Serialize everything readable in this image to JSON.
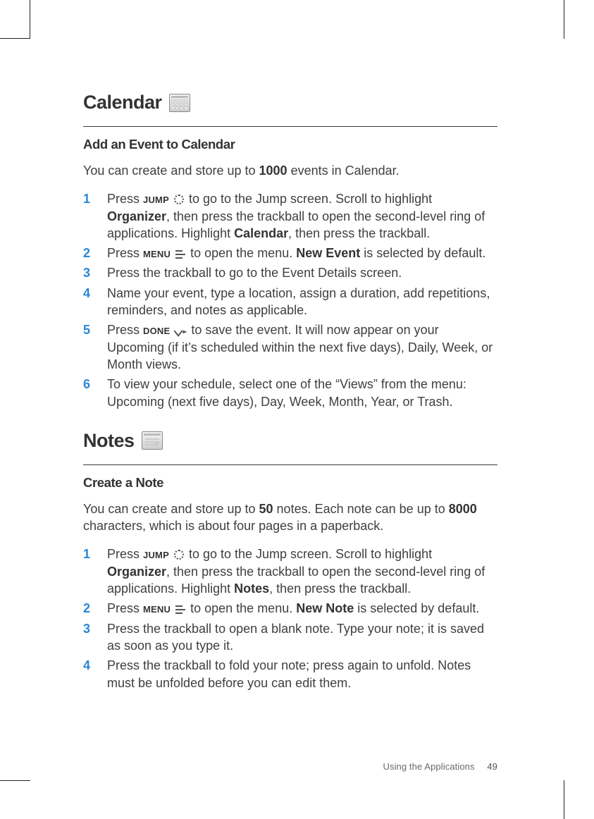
{
  "footer": {
    "section": "Using the Applications",
    "page": "49"
  },
  "keys": {
    "jump": "JUMP",
    "menu": "MENU",
    "done": "DONE"
  },
  "calendar": {
    "title": "Calendar",
    "sub": "Add an Event to Calendar",
    "intro_a": "You can create and store up to ",
    "intro_b": "1000",
    "intro_c": " events in Calendar.",
    "steps": [
      {
        "n": "1",
        "parts": [
          {
            "t": "text",
            "v": "Press "
          },
          {
            "t": "key",
            "v": "jump"
          },
          {
            "t": "glyph",
            "v": "jump"
          },
          {
            "t": "text",
            "v": " to go to the Jump screen. Scroll to highlight "
          },
          {
            "t": "bold",
            "v": "Organizer"
          },
          {
            "t": "text",
            "v": ", then press the trackball to open the second-level ring of applications. Highlight "
          },
          {
            "t": "bold",
            "v": "Calendar"
          },
          {
            "t": "text",
            "v": ", then press the trackball."
          }
        ]
      },
      {
        "n": "2",
        "parts": [
          {
            "t": "text",
            "v": "Press "
          },
          {
            "t": "key",
            "v": "menu"
          },
          {
            "t": "glyph",
            "v": "menu"
          },
          {
            "t": "text",
            "v": " to open the menu. "
          },
          {
            "t": "bold",
            "v": "New Event"
          },
          {
            "t": "text",
            "v": " is selected by default."
          }
        ]
      },
      {
        "n": "3",
        "parts": [
          {
            "t": "text",
            "v": "Press the trackball to go to the Event Details screen."
          }
        ]
      },
      {
        "n": "4",
        "parts": [
          {
            "t": "text",
            "v": "Name your event, type a location, assign a duration, add repetitions, reminders, and notes as applicable."
          }
        ]
      },
      {
        "n": "5",
        "parts": [
          {
            "t": "text",
            "v": "Press "
          },
          {
            "t": "key",
            "v": "done"
          },
          {
            "t": "glyph",
            "v": "done"
          },
          {
            "t": "text",
            "v": " to save the event. It will now appear on your Upcoming (if it’s scheduled within the next five days), Daily, Week, or Month views."
          }
        ]
      },
      {
        "n": "6",
        "parts": [
          {
            "t": "text",
            "v": "To view your schedule, select one of the “Views” from the menu: Upcoming (next five days), Day, Week, Month, Year, or Trash."
          }
        ]
      }
    ]
  },
  "notes": {
    "title": "Notes",
    "sub": "Create a Note",
    "intro_a": "You can create and store up to ",
    "intro_b": "50",
    "intro_c": " notes. Each note can be up to ",
    "intro_d": "8000",
    "intro_e": " characters, which is about four pages in a paperback.",
    "steps": [
      {
        "n": "1",
        "parts": [
          {
            "t": "text",
            "v": "Press "
          },
          {
            "t": "key",
            "v": "jump"
          },
          {
            "t": "glyph",
            "v": "jump"
          },
          {
            "t": "text",
            "v": " to go to the Jump screen. Scroll to highlight "
          },
          {
            "t": "bold",
            "v": "Organizer"
          },
          {
            "t": "text",
            "v": ", then press the trackball to open the second-level ring of applications. Highlight "
          },
          {
            "t": "bold",
            "v": "Notes"
          },
          {
            "t": "text",
            "v": ", then press the trackball."
          }
        ]
      },
      {
        "n": "2",
        "parts": [
          {
            "t": "text",
            "v": "Press "
          },
          {
            "t": "key",
            "v": "menu"
          },
          {
            "t": "glyph",
            "v": "menu"
          },
          {
            "t": "text",
            "v": " to open the menu. "
          },
          {
            "t": "bold",
            "v": "New Note"
          },
          {
            "t": "text",
            "v": " is selected by default."
          }
        ]
      },
      {
        "n": "3",
        "parts": [
          {
            "t": "text",
            "v": "Press the trackball to open a blank note. Type your note; it is saved as soon as you type it."
          }
        ]
      },
      {
        "n": "4",
        "parts": [
          {
            "t": "text",
            "v": "Press the trackball to fold your note; press again to unfold. Notes must be unfolded before you can edit them."
          }
        ]
      }
    ]
  }
}
